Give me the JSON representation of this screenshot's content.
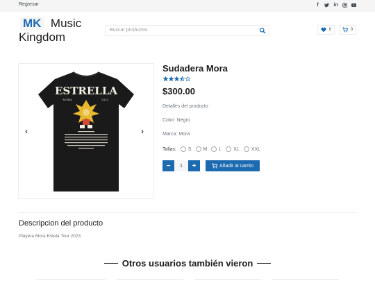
{
  "topbar": {
    "back_label": "Regresar",
    "socials": [
      "facebook-icon",
      "twitter-icon",
      "linkedin-icon",
      "instagram-icon",
      "youtube-icon"
    ]
  },
  "logo": {
    "mk": "MK",
    "line1": "Music",
    "line2": "Kingdom"
  },
  "search": {
    "placeholder": "Buscar productos"
  },
  "header": {
    "wishlist_count": "0",
    "cart_count": "0"
  },
  "product": {
    "image": {
      "brand_title": "ESTRELLA",
      "left_caption": "MORA",
      "right_caption": "2023"
    },
    "title": "Sudadera Mora",
    "rating": 3.5,
    "price": "$300.00",
    "details_label": "Detalles del producto",
    "color": "Color: Negro",
    "brand": "Marca: Mora",
    "sizes_label": "Tallas:",
    "sizes": [
      "S",
      "M",
      "L",
      "XL",
      "XXL"
    ],
    "quantity": "1",
    "add_to_cart": "Añadir al carrito"
  },
  "description": {
    "title": "Descripcion del producto",
    "text": "Playera Mora Estela Tour 2023"
  },
  "related": {
    "title": "Otros usuarios también vieron"
  },
  "colors": {
    "accent": "#1c6ab0",
    "topbar": "#f5f5f5",
    "text": "#1c1c1c"
  }
}
